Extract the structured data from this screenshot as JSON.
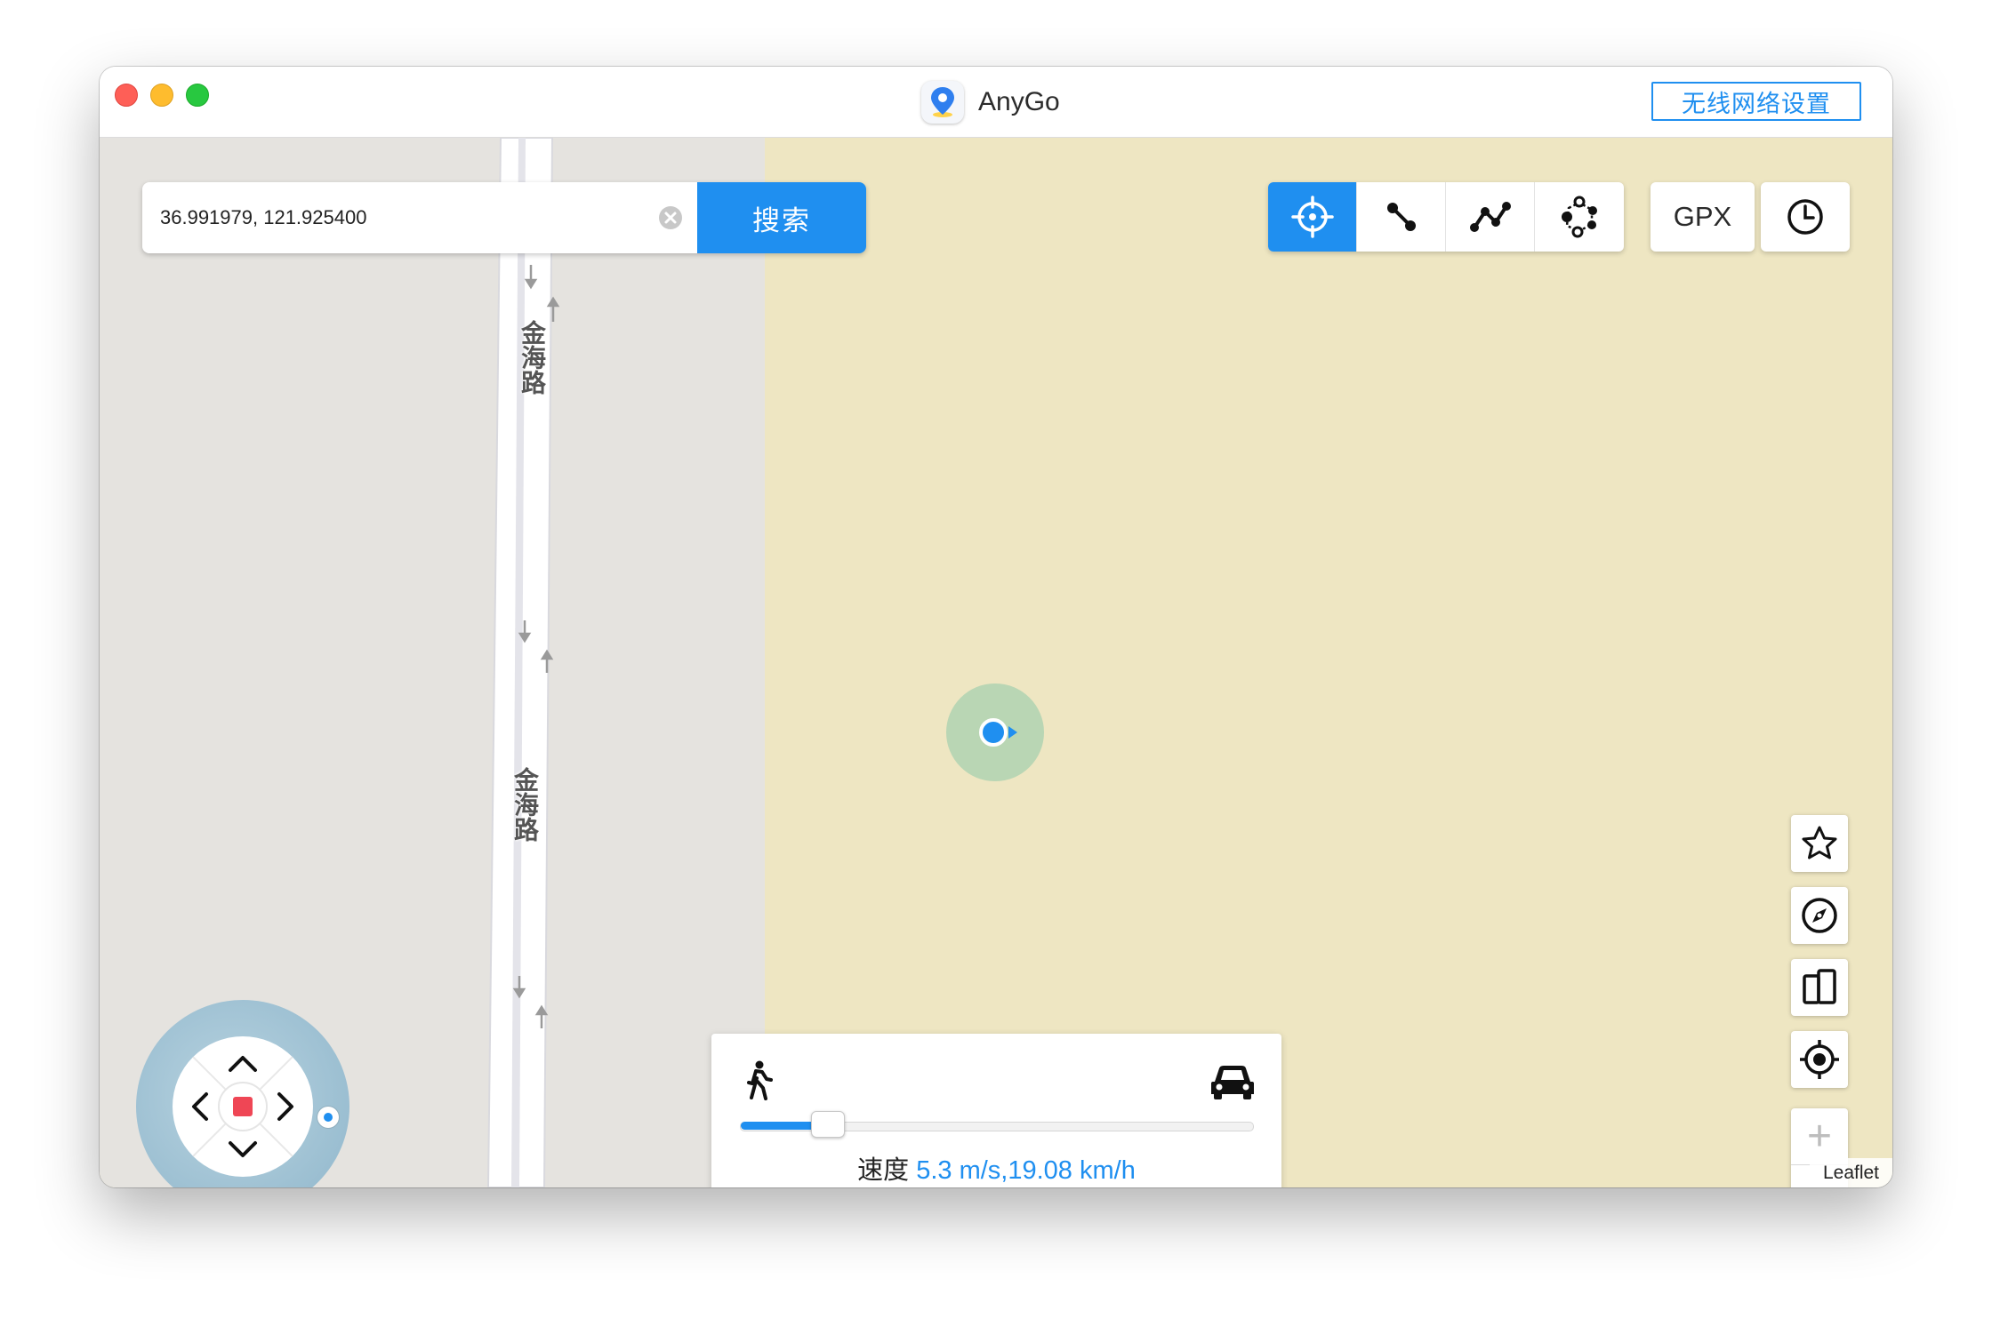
{
  "window": {
    "app_name": "AnyGo",
    "wifi_button_label": "无线网络设置"
  },
  "search": {
    "value": "36.991979, 121.925400",
    "button_label": "搜索"
  },
  "toolbar": {
    "modes": [
      {
        "icon": "crosshair-icon",
        "active": true
      },
      {
        "icon": "two-point-route-icon",
        "active": false
      },
      {
        "icon": "multi-point-route-icon",
        "active": false
      },
      {
        "icon": "jump-teleport-icon",
        "active": false
      }
    ],
    "gpx_label": "GPX",
    "history_icon": "clock-icon"
  },
  "map": {
    "road_labels": [
      "金海路",
      "金海路"
    ],
    "attribution": "Leaflet",
    "colors": {
      "land": "#eee6c2",
      "urban": "#e5e3df",
      "accent": "#1f8ff0"
    }
  },
  "side_controls": [
    "star-icon",
    "compass-icon",
    "device-icon",
    "locate-icon"
  ],
  "zoom": {
    "in": "+",
    "out": "−"
  },
  "speed": {
    "label": "速度",
    "value": "5.3 m/s,19.08 km/h",
    "slider_fraction": 0.17
  }
}
